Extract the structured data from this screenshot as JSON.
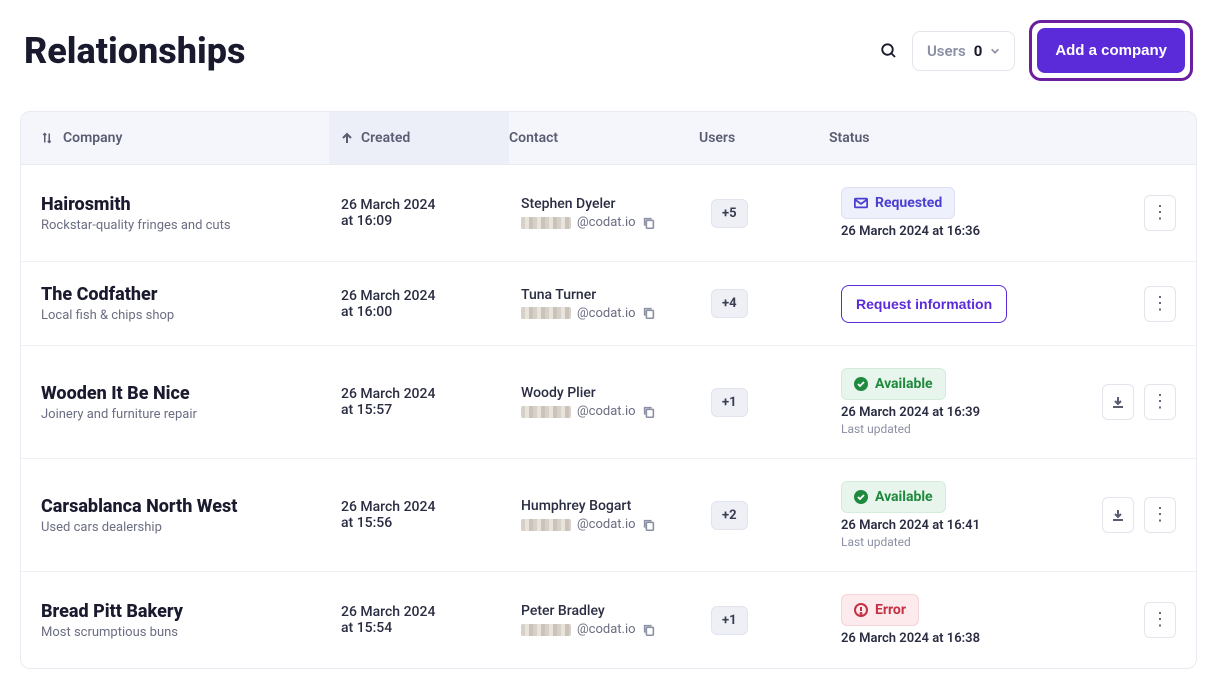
{
  "page": {
    "title": "Relationships"
  },
  "header": {
    "users_label": "Users",
    "users_count": "0",
    "add_button": "Add a company"
  },
  "columns": {
    "company": "Company",
    "created": "Created",
    "contact": "Contact",
    "users": "Users",
    "status": "Status"
  },
  "status_labels": {
    "requested": "Requested",
    "available": "Available",
    "error": "Error",
    "request_info": "Request information",
    "last_updated": "Last updated"
  },
  "rows": [
    {
      "company": "Hairosmith",
      "desc": "Rockstar-quality fringes and cuts",
      "created_l1": "26 March 2024",
      "created_l2": "at 16:09",
      "contact": "Stephen Dyeler",
      "email_domain": "@codat.io",
      "users": "+5",
      "status_type": "requested",
      "status_time": "26 March 2024 at 16:36"
    },
    {
      "company": "The Codfather",
      "desc": "Local fish & chips shop",
      "created_l1": "26 March 2024",
      "created_l2": "at 16:00",
      "contact": "Tuna Turner",
      "email_domain": "@codat.io",
      "users": "+4",
      "status_type": "request_btn"
    },
    {
      "company": "Wooden It Be Nice",
      "desc": "Joinery and furniture repair",
      "created_l1": "26 March 2024",
      "created_l2": "at 15:57",
      "contact": "Woody Plier",
      "email_domain": "@codat.io",
      "users": "+1",
      "status_type": "available",
      "status_time": "26 March 2024 at 16:39",
      "has_download": true
    },
    {
      "company": "Carsablanca North West",
      "desc": "Used cars dealership",
      "created_l1": "26 March 2024",
      "created_l2": "at 15:56",
      "contact": "Humphrey Bogart",
      "email_domain": "@codat.io",
      "users": "+2",
      "status_type": "available",
      "status_time": "26 March 2024 at 16:41",
      "has_download": true
    },
    {
      "company": "Bread Pitt Bakery",
      "desc": "Most scrumptious buns",
      "created_l1": "26 March 2024",
      "created_l2": "at 15:54",
      "contact": "Peter Bradley",
      "email_domain": "@codat.io",
      "users": "+1",
      "status_type": "error",
      "status_time": "26 March 2024 at 16:38"
    }
  ]
}
